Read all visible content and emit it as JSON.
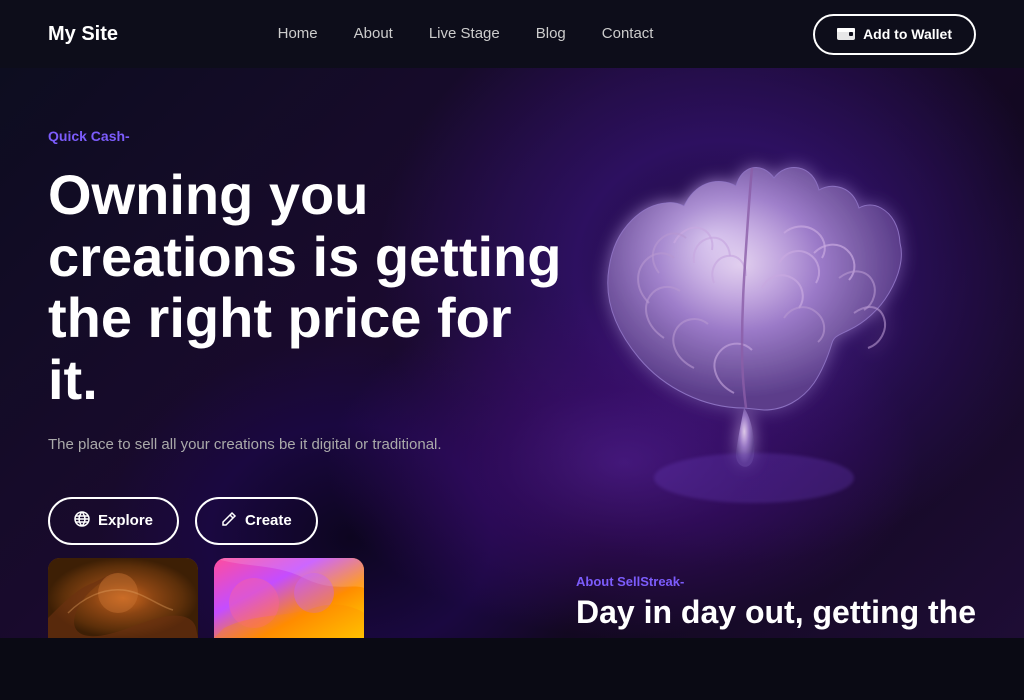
{
  "site": {
    "logo": "My Site"
  },
  "nav": {
    "links": [
      {
        "label": "Home",
        "id": "home"
      },
      {
        "label": "About",
        "id": "about"
      },
      {
        "label": "Live Stage",
        "id": "live-stage"
      },
      {
        "label": "Blog",
        "id": "blog"
      },
      {
        "label": "Contact",
        "id": "contact"
      }
    ],
    "wallet_button": "Add to Wallet"
  },
  "hero": {
    "tag": "Quick Cash-",
    "title": "Owning you creations is getting the right price for it.",
    "subtitle": "The place to sell all your creations be it digital or traditional.",
    "btn_explore": "Explore",
    "btn_create": "Create"
  },
  "about_peek": {
    "tag": "About SellStreak-",
    "title": "Day in day out, getting the"
  },
  "colors": {
    "accent": "#7c5cfc",
    "bg_dark": "#0a0a14",
    "bg_nav": "#0d0d1a"
  }
}
